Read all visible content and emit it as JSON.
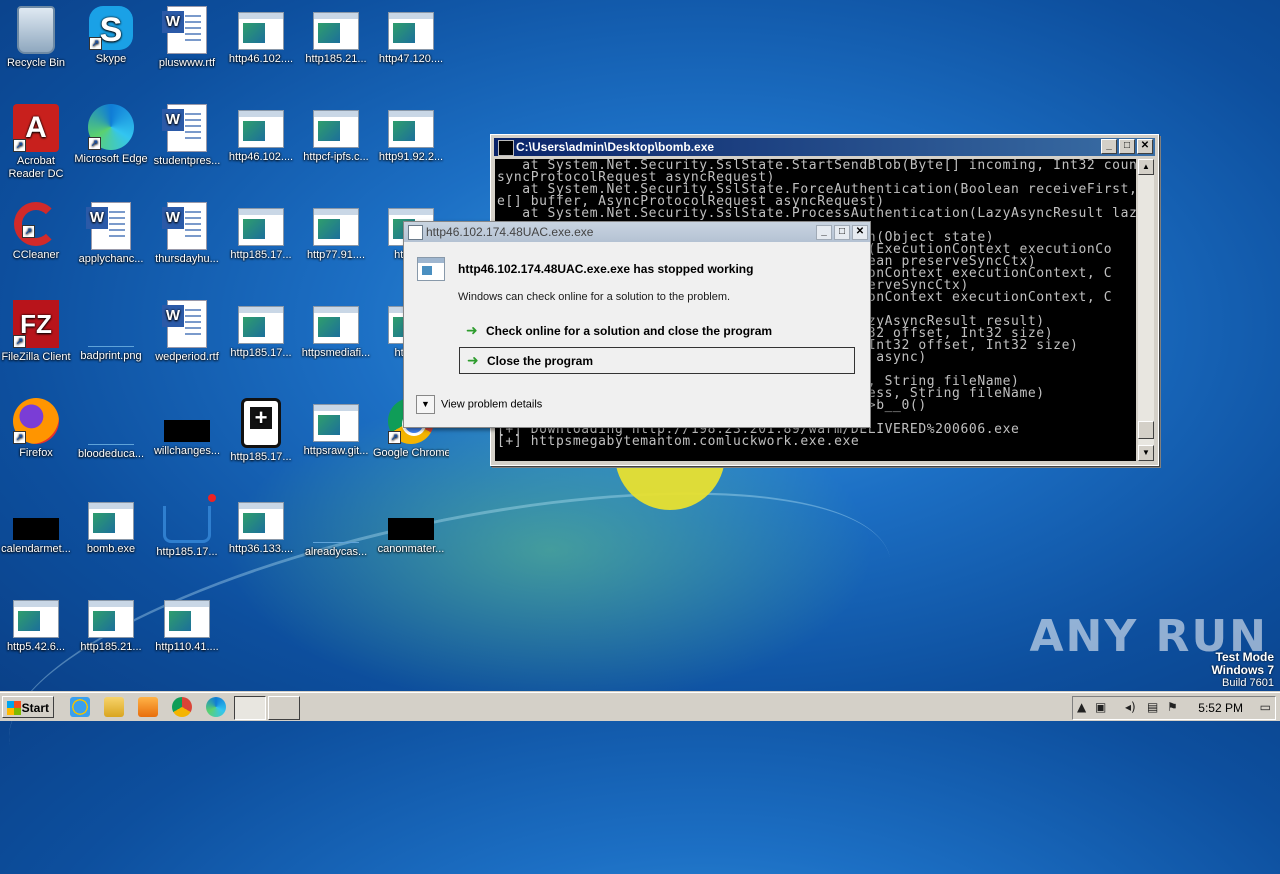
{
  "desktop_icons": [
    {
      "label": "Recycle Bin",
      "icon": "recycle-bin-icon"
    },
    {
      "label": "Skype",
      "icon": "skype-icon"
    },
    {
      "label": "pluswww.rtf",
      "icon": "word-doc-icon"
    },
    {
      "label": "http46.102....",
      "icon": "exe-window-icon"
    },
    {
      "label": "http185.21...",
      "icon": "exe-window-icon"
    },
    {
      "label": "http47.120....",
      "icon": "exe-window-icon"
    },
    {
      "label": "Acrobat Reader DC",
      "icon": "acrobat-icon"
    },
    {
      "label": "Microsoft Edge",
      "icon": "edge-icon"
    },
    {
      "label": "studentpres...",
      "icon": "word-doc-icon"
    },
    {
      "label": "http46.102....",
      "icon": "exe-window-icon"
    },
    {
      "label": "httpcf-ipfs.c...",
      "icon": "exe-window-icon"
    },
    {
      "label": "http91.92.2...",
      "icon": "exe-window-icon"
    },
    {
      "label": "CCleaner",
      "icon": "ccleaner-icon"
    },
    {
      "label": "applychanc...",
      "icon": "word-doc-icon"
    },
    {
      "label": "thursdayhu...",
      "icon": "word-doc-icon"
    },
    {
      "label": "http185.17...",
      "icon": "exe-window-icon"
    },
    {
      "label": "http77.91....",
      "icon": "exe-window-icon"
    },
    {
      "label": "http1...",
      "icon": "exe-window-icon"
    },
    {
      "label": "FileZilla Client",
      "icon": "filezilla-icon"
    },
    {
      "label": "badprint.png",
      "icon": "image-file-icon"
    },
    {
      "label": "wedperiod.rtf",
      "icon": "word-doc-icon"
    },
    {
      "label": "http185.17...",
      "icon": "exe-window-icon"
    },
    {
      "label": "httpsmediafi...",
      "icon": "exe-window-icon"
    },
    {
      "label": "https...",
      "icon": "exe-window-icon"
    },
    {
      "label": "Firefox",
      "icon": "firefox-icon"
    },
    {
      "label": "bloodeduca...",
      "icon": "image-file-icon"
    },
    {
      "label": "willchanges...",
      "icon": "black-file-icon"
    },
    {
      "label": "http185.17...",
      "icon": "medkit-icon"
    },
    {
      "label": "httpsraw.git...",
      "icon": "exe-window-icon"
    },
    {
      "label": "Google Chrome",
      "icon": "chrome-icon"
    },
    {
      "label": "calendarmet...",
      "icon": "black-file-icon"
    },
    {
      "label": "bomb.exe",
      "icon": "exe-window-icon"
    },
    {
      "label": "http185.17...",
      "icon": "cart-icon"
    },
    {
      "label": "http36.133....",
      "icon": "exe-window-icon"
    },
    {
      "label": "alreadycas...",
      "icon": "image-file-icon"
    },
    {
      "label": "canonmater...",
      "icon": "black-file-icon"
    },
    {
      "label": "http5.42.6...",
      "icon": "exe-window-icon"
    },
    {
      "label": "http185.21...",
      "icon": "exe-window-icon"
    },
    {
      "label": "http110.41....",
      "icon": "exe-window-icon"
    }
  ],
  "console": {
    "title": "C:\\Users\\admin\\Desktop\\bomb.exe",
    "lines": [
      "   at System.Net.Security.SslState.StartSendBlob(Byte[] incoming, Int32 count, A",
      "syncProtocolRequest asyncRequest)",
      "   at System.Net.Security.SslState.ForceAuthentication(Boolean receiveFirst, Byt",
      "e[] buffer, AsyncProtocolRequest asyncRequest)",
      "   at System.Net.Security.SslState.ProcessAuthentication(LazyAsyncResult lazyRes",
      "",
      "                                        ation(Object state)",
      "                                        rnal(ExecutionContext executionCo",
      "                                        Boolean preserveSyncCtx)",
      "                                        cutionContext executionContext, C",
      "                                        preserveSyncCtx)",
      "                                        cutionContext executionContext, C",
      "",
      "                                        n(LazyAsyncResult result)",
      "                                         Int32 offset, Int32 size)",
      "                                        er, Int32 offset, Int32 size)",
      "                                        lean async)",
      "",
      "                                        ress, String fileName)",
      "                                        address, String fileName)",
      "                                        Main>b__0()",
      "                                        exe",
      "[+] Downloading http://198.23.201.89/warm/DELIVERED%200606.exe",
      "[+] httpsmegabytemantom.comluckwork.exe.exe"
    ]
  },
  "error_dialog": {
    "title": "http46.102.174.48UAC.exe.exe",
    "headline": "http46.102.174.48UAC.exe.exe has stopped working",
    "message": "Windows can check online for a solution to the problem.",
    "option_check": "Check online for a solution and close the program",
    "option_close": "Close the program",
    "details": "View problem details"
  },
  "taskbar": {
    "start_label": "Start",
    "clock": "5:52 PM",
    "pinned": [
      "ie-icon",
      "explorer-icon",
      "media-player-icon",
      "chrome-icon",
      "edge-icon"
    ]
  },
  "watermark": "ANY RUN",
  "test_mode": {
    "line1": "Test Mode",
    "line2": "Windows 7",
    "line3": "Build 7601"
  }
}
